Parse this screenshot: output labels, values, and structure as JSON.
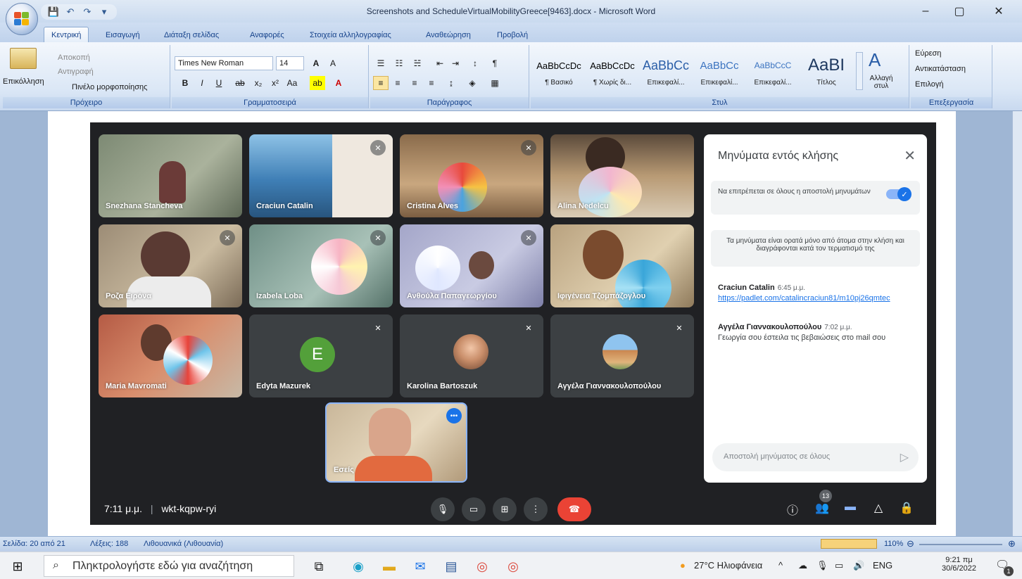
{
  "window": {
    "title": "Screenshots and ScheduleVirtualMobilityGreece[9463].docx - Microsoft Word",
    "minimize": "–",
    "maximize": "▢",
    "close": "✕"
  },
  "qat": {
    "save": "💾",
    "undo": "↶",
    "redo": "↷",
    "more": "▾"
  },
  "ribbon": {
    "tabs": [
      "Κεντρική",
      "Εισαγωγή",
      "Διάταξη σελίδας",
      "Αναφορές",
      "Στοιχεία αλληλογραφίας",
      "Αναθεώρηση",
      "Προβολή"
    ],
    "clipboard": {
      "label": "Πρόχειρο",
      "paste": "Επικόλληση",
      "cut": "Αποκοπή",
      "copy": "Αντιγραφή",
      "format_painter": "Πινέλο μορφοποίησης"
    },
    "font": {
      "label": "Γραμματοσειρά",
      "name": "Times New Roman",
      "size": "14"
    },
    "paragraph": {
      "label": "Παράγραφος"
    },
    "styles": {
      "label": "Στυλ",
      "items": [
        {
          "sample": "AaBbCcDc",
          "name": "¶ Βασικό"
        },
        {
          "sample": "AaBbCcDc",
          "name": "¶ Χωρίς δι..."
        },
        {
          "sample": "AaBbCc",
          "name": "Επικεφαλί..."
        },
        {
          "sample": "AaBbCc",
          "name": "Επικεφαλί..."
        },
        {
          "sample": "AaBbCcC",
          "name": "Επικεφαλί..."
        },
        {
          "sample": "AaBI",
          "name": "Τίτλος"
        }
      ],
      "change_styles": "Αλλαγή στυλ"
    },
    "editing": {
      "label": "Επεξεργασία",
      "find": "Εύρεση",
      "replace": "Αντικατάσταση",
      "select": "Επιλογή"
    }
  },
  "meeting": {
    "tiles": [
      {
        "name": "Snezhana Stancheva",
        "muted": false
      },
      {
        "name": "Craciun Catalin",
        "muted": true
      },
      {
        "name": "Cristina Alves",
        "muted": true
      },
      {
        "name": "Alina Nedelcu",
        "muted": false
      },
      {
        "name": "Ροζα Ειρόνα",
        "muted": true
      },
      {
        "name": "Izabela Loba",
        "muted": true
      },
      {
        "name": "Ανθούλα Παπαγεωργίου",
        "muted": true
      },
      {
        "name": "Ιφιγένεια Τζομπάζογλου",
        "muted": false
      },
      {
        "name": "Maria Mavromati",
        "muted": false
      },
      {
        "name": "Edyta Mazurek",
        "muted": true,
        "initial": "E"
      },
      {
        "name": "Karolina Bartoszuk",
        "muted": true
      },
      {
        "name": "Αγγέλα Γιαννακουλοπούλου",
        "muted": true
      },
      {
        "name": "Εσείς",
        "muted": false
      }
    ],
    "chat": {
      "title": "Μηνύματα εντός κλήσης",
      "allow_label": "Να επιτρέπεται σε όλους η αποστολή μηνυμάτων",
      "notice": "Τα μηνύματα είναι ορατά μόνο από άτομα στην κλήση και διαγράφονται κατά τον τερματισμό της",
      "messages": [
        {
          "sender": "Craciun Catalin",
          "time": "6:45 μ.μ.",
          "text": "https://padlet.com/catalincraciun81/m10pj26qmtec"
        },
        {
          "sender": "Αγγέλα Γιαννακουλοπούλου",
          "time": "7:02 μ.μ.",
          "text": "Γεωργία σου έστειλα τις βεβαιώσεις στο mail σου"
        }
      ],
      "input_placeholder": "Αποστολή μηνύματος σε όλους"
    },
    "time": "7:11 μ.μ.",
    "meeting_code": "wkt-kqpw-ryi",
    "participants_count": "13"
  },
  "statusbar": {
    "page": "Σελίδα: 20 από 21",
    "words": "Λέξεις: 188",
    "language": "Λιθουανικά (Λιθουανία)",
    "zoom": "110%"
  },
  "taskbar": {
    "search_placeholder": "Πληκτρολογήστε εδώ για αναζήτηση",
    "weather": "27°C Ηλιοφάνεια",
    "lang": "ENG",
    "time": "9:21 πμ",
    "date": "30/6/2022",
    "notif_count": "1"
  }
}
